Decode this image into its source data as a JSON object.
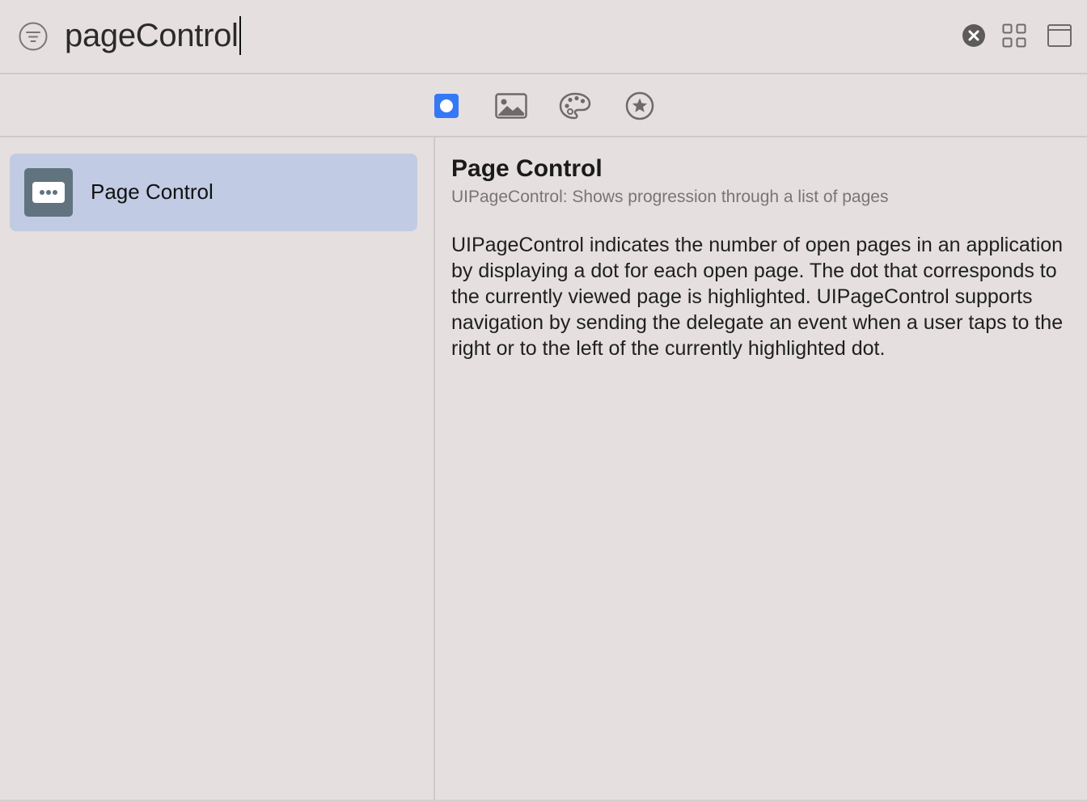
{
  "search": {
    "query": "pageControl",
    "filter_icon": "filter-icon",
    "clear_icon": "clear-circle-icon"
  },
  "toolbar": {
    "grid_icon": "grid-view-icon",
    "window_icon": "window-icon"
  },
  "tabs": [
    {
      "name": "objects",
      "icon": "objects-icon",
      "selected": true
    },
    {
      "name": "media",
      "icon": "image-icon",
      "selected": false
    },
    {
      "name": "colors",
      "icon": "palette-icon",
      "selected": false
    },
    {
      "name": "snippets",
      "icon": "star-circle-icon",
      "selected": false
    }
  ],
  "list": {
    "items": [
      {
        "label": "Page Control",
        "icon": "page-control-icon",
        "selected": true
      }
    ]
  },
  "detail": {
    "title": "Page Control",
    "subtitle": "UIPageControl: Shows progression through a list of pages",
    "description": "UIPageControl indicates the number of open pages in an application by displaying a dot for each open page. The dot that corresponds to the currently viewed page is highlighted. UIPageControl supports navigation by sending the delegate an event when a user taps to the right or to the left of the currently highlighted dot."
  },
  "colors": {
    "background": "#e5dfdf",
    "accent": "#3478f6",
    "selection": "#c1cbe3",
    "icon_tile": "#627380",
    "icon_gray": "#6e6a6a"
  }
}
